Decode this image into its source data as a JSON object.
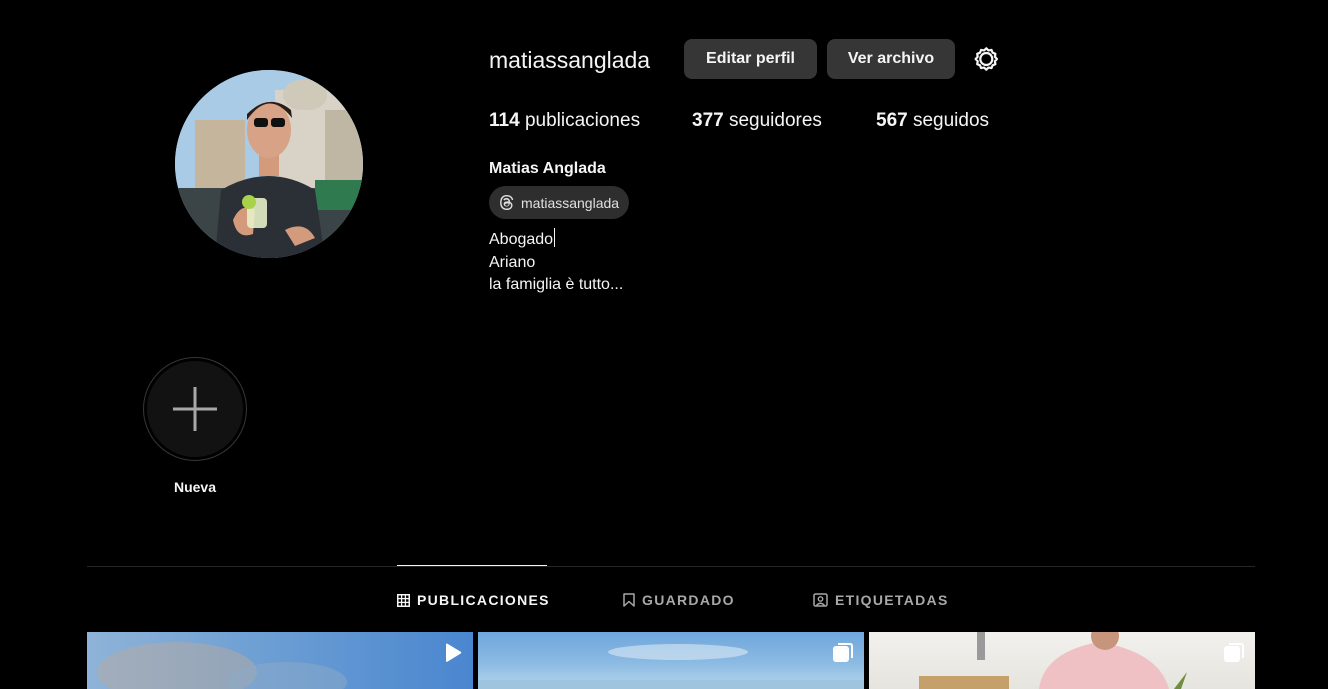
{
  "profile": {
    "username": "matiassanglada",
    "edit_button": "Editar perfil",
    "archive_button": "Ver archivo",
    "full_name": "Matias Anglada",
    "threads_handle": "matiassanglada",
    "bio_lines": [
      "Abogado",
      "Ariano",
      "la famiglia è tutto..."
    ]
  },
  "stats": {
    "posts_count": "114",
    "posts_label": "publicaciones",
    "followers_count": "377",
    "followers_label": "seguidores",
    "following_count": "567",
    "following_label": "seguidos"
  },
  "highlights": {
    "new_label": "Nueva"
  },
  "tabs": [
    {
      "label": "PUBLICACIONES",
      "icon": "grid-icon",
      "active": true
    },
    {
      "label": "GUARDADO",
      "icon": "bookmark-icon",
      "active": false
    },
    {
      "label": "ETIQUETADAS",
      "icon": "tagged-icon",
      "active": false
    }
  ],
  "posts": [
    {
      "type": "reel",
      "icon": "reel-icon"
    },
    {
      "type": "carousel",
      "icon": "carousel-icon"
    },
    {
      "type": "carousel",
      "icon": "carousel-icon"
    }
  ],
  "colors": {
    "background": "#000000",
    "button_bg": "#363636",
    "text": "#f5f5f5",
    "muted_text": "#a8a8a8",
    "divider": "#262626"
  }
}
